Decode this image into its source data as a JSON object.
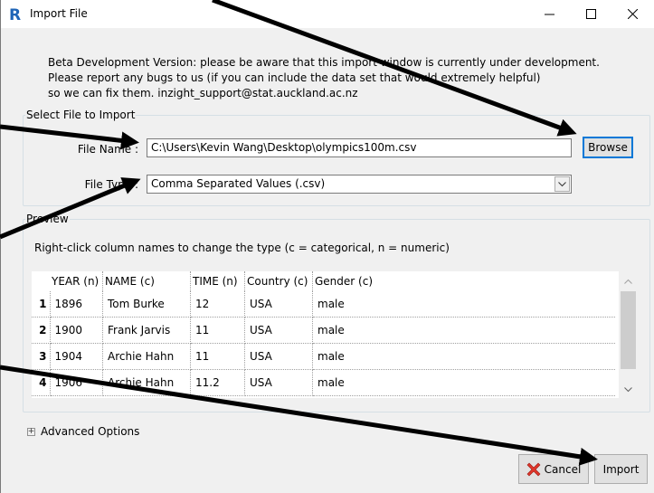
{
  "window": {
    "title": "Import File",
    "app_icon_letter": "R",
    "controls": {
      "minimize": "—",
      "maximize": "☐",
      "close": "✕"
    }
  },
  "notice": {
    "lines": [
      "Beta Development Version: please be aware that this import window is currently under development.",
      "Please report any bugs to us (if you can include the data set that would extremely helpful)",
      "so we can fix them. inzight_support@stat.auckland.ac.nz"
    ]
  },
  "select_file": {
    "legend": "Select File to Import",
    "file_name_label": "File Name :",
    "file_name_value": "C:\\Users\\Kevin Wang\\Desktop\\olympics100m.csv",
    "browse_label": "Browse",
    "file_type_label": "File Type :",
    "file_type_value": "Comma Separated Values (.csv)"
  },
  "preview": {
    "legend": "Preview",
    "hint": "Right-click column names to change the type (c = categorical, n = numeric)",
    "columns": [
      "YEAR (n)",
      "NAME (c)",
      "TIME (n)",
      "Country (c)",
      "Gender (c)"
    ],
    "rows": [
      {
        "num": "1",
        "cells": [
          "1896",
          "Tom Burke",
          "12",
          "USA",
          "male"
        ]
      },
      {
        "num": "2",
        "cells": [
          "1900",
          "Frank Jarvis",
          "11",
          "USA",
          "male"
        ]
      },
      {
        "num": "3",
        "cells": [
          "1904",
          "Archie Hahn",
          "11",
          "USA",
          "male"
        ]
      },
      {
        "num": "4",
        "cells": [
          "1906",
          "Archie Hahn",
          "11.2",
          "USA",
          "male"
        ]
      }
    ]
  },
  "advanced": {
    "label": "Advanced Options",
    "toggle": "+"
  },
  "footer": {
    "cancel_label": "Cancel",
    "import_label": "Import"
  },
  "colors": {
    "accent": "#0078d7",
    "r_icon": "#1f65b7",
    "cancel_icon": "#e0362b",
    "arrow": "#000000"
  }
}
